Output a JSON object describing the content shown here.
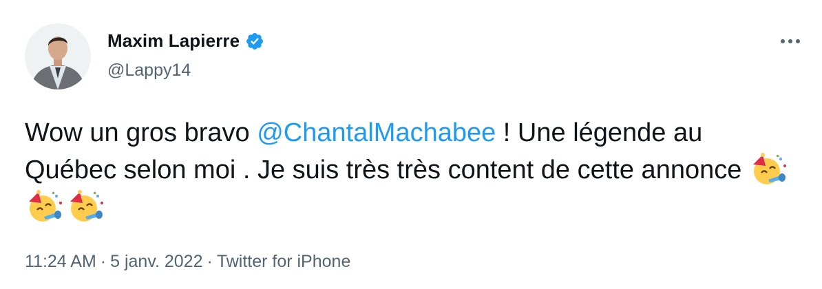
{
  "author": {
    "display_name": "Maxim Lapierre",
    "handle": "@Lappy14",
    "verified": true
  },
  "menu": {
    "more_icon": "more-horizontal-icon"
  },
  "tweet": {
    "text_before_mention": "Wow un gros bravo ",
    "mention": "@ChantalMachabee",
    "text_after_mention": " ! Une légende au Québec selon moi . Je suis très très content de cette annonce ",
    "emojis": [
      "party-face-emoji",
      "party-face-emoji",
      "party-face-emoji"
    ]
  },
  "meta": {
    "time": "11:24 AM",
    "date": "5 janv. 2022",
    "source": "Twitter for iPhone",
    "separator": "·"
  },
  "colors": {
    "link": "#1d9bf0",
    "text": "#0f1419",
    "secondary": "#536471",
    "verified": "#1d9bf0"
  }
}
